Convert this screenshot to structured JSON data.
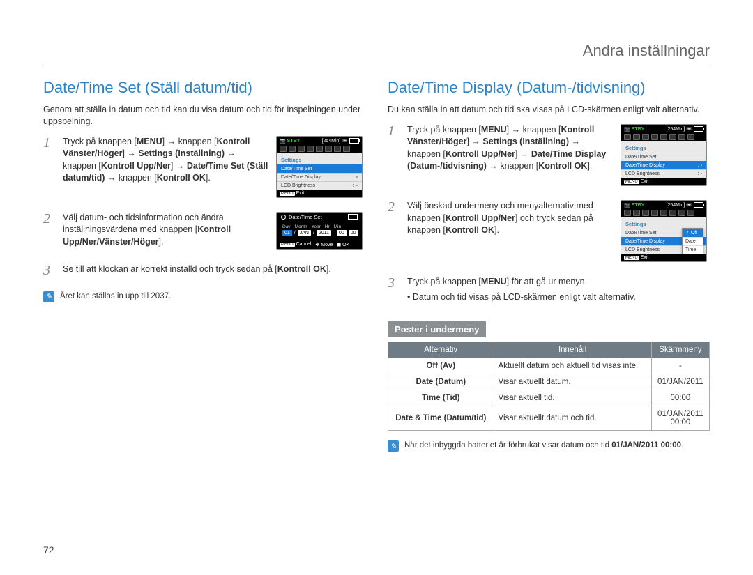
{
  "header": {
    "title": "Andra inställningar"
  },
  "pageNumber": "72",
  "left": {
    "title": "Date/Time Set (Ställ datum/tid)",
    "intro": "Genom att ställa in datum och tid kan du visa datum och tid för inspelningen under uppspelning.",
    "steps": {
      "1": {
        "p1": "Tryck på knappen [",
        "p2": "MENU",
        "p3": "] → knappen [",
        "p4": "Kontroll Vänster/Höger",
        "p5": "] → ",
        "p6": "Settings (Inställning)",
        "p7": " → knappen [",
        "p8": "Kontroll Upp/Ner",
        "p9": "] → ",
        "p10": "Date/Time Set (Ställ datum/tid)",
        "p11": " → knappen [",
        "p12": "Kontroll OK",
        "p13": "]."
      },
      "2": {
        "p1": "Välj datum- och tidsinformation och ändra inställningsvärdena med knappen [",
        "p2": "Kontroll Upp/Ner/Vänster/Höger",
        "p3": "]."
      },
      "3": {
        "p1": "Se till att klockan är korrekt inställd och tryck sedan på [",
        "p2": "Kontroll OK",
        "p3": "]."
      }
    },
    "note": "Året kan ställas in upp till 2037.",
    "lcd1": {
      "stby": "STBY",
      "time": "[254Min]",
      "head": "Settings",
      "items": [
        "Date/Time Set",
        "Date/Time Display",
        "LCD Brightness"
      ],
      "exit_tag": "MENU",
      "exit": "Exit"
    },
    "lcd2": {
      "title": "Date/Time Set",
      "labels": [
        "Day",
        "Month",
        "Year",
        "Hr",
        "Min"
      ],
      "vals": {
        "day": "01",
        "month": "JAN",
        "year": "2011",
        "hr": "00",
        "min": "00"
      },
      "cancel_tag": "MENU",
      "cancel": "Cancel",
      "move": "Move",
      "ok": "OK"
    }
  },
  "right": {
    "title": "Date/Time Display (Datum-/tidvisning)",
    "intro": "Du kan ställa in att datum och tid ska visas på LCD-skärmen enligt valt alternativ.",
    "steps": {
      "1": {
        "p1": "Tryck på knappen [",
        "p2": "MENU",
        "p3": "] → knappen [",
        "p4": "Kontroll Vänster/Höger",
        "p5": "] → ",
        "p6": "Settings (Inställning)",
        "p7": " → knappen [",
        "p8": "Kontroll Upp/Ner",
        "p9": "] → ",
        "p10": "Date/Time Display (Datum-/tidvisning)",
        "p11": " → knappen [",
        "p12": "Kontroll OK",
        "p13": "]."
      },
      "2": {
        "p1": "Välj önskad undermeny och menyalternativ med knappen [",
        "p2": "Kontroll Upp/Ner",
        "p3": "] och tryck sedan på knappen [",
        "p4": "Kontroll OK",
        "p5": "]."
      },
      "3": {
        "p1": "Tryck på knappen [",
        "p2": "MENU",
        "p3": "] för att gå ur menyn.",
        "bullet": "Datum och tid visas på LCD-skärmen enligt valt alternativ."
      }
    },
    "subhead": "Poster i undermeny",
    "table": {
      "headers": [
        "Alternativ",
        "Innehåll",
        "Skärmmeny"
      ],
      "rows": [
        {
          "a": "Off (Av)",
          "b": "Aktuellt datum och aktuell tid visas inte.",
          "c": "-"
        },
        {
          "a": "Date (Datum)",
          "b": "Visar aktuellt datum.",
          "c": "01/JAN/2011"
        },
        {
          "a": "Time (Tid)",
          "b": "Visar aktuell tid.",
          "c": "00:00"
        },
        {
          "a": "Date & Time (Datum/tid)",
          "b": "Visar aktuellt datum och tid.",
          "c": "01/JAN/2011\n00:00"
        }
      ]
    },
    "note": {
      "p1": "När det inbyggda batteriet är förbrukat visar datum och tid ",
      "p2": "01/JAN/2011 00:00",
      "p3": "."
    },
    "lcd1": {
      "stby": "STBY",
      "time": "[254Min]",
      "head": "Settings",
      "items": [
        "Date/Time Set",
        "Date/Time Display",
        "LCD Brightness"
      ],
      "exit_tag": "MENU",
      "exit": "Exit"
    },
    "lcd2": {
      "stby": "STBY",
      "time": "[254Min]",
      "head": "Settings",
      "items": [
        "Date/Time Set",
        "Date/Time Display",
        "LCD Brightness"
      ],
      "dropdown": [
        "Off",
        "Date",
        "Time"
      ],
      "exit_tag": "MENU",
      "exit": "Exit"
    }
  }
}
